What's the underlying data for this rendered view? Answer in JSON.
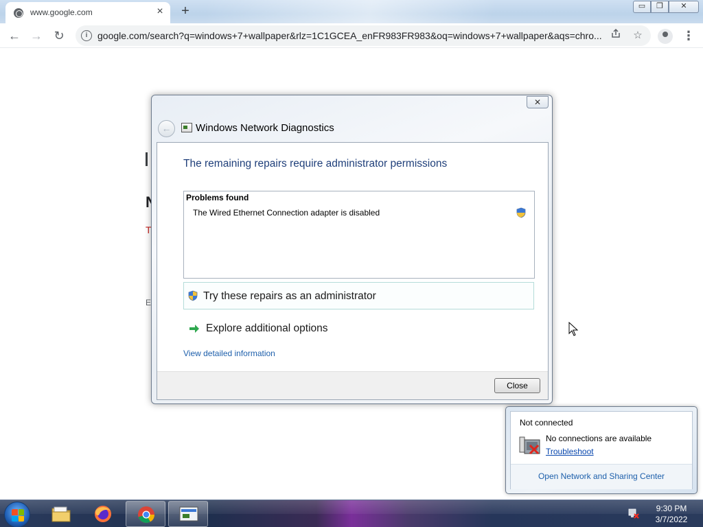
{
  "browser": {
    "tab_title": "www.google.com",
    "tab_close": "×",
    "new_tab": "+",
    "url": "google.com/search?q=windows+7+wallpaper&rlz=1C1GCEA_enFR983FR983&oq=windows+7+wallpaper&aqs=chro...",
    "window_controls": {
      "minimize": "▭",
      "maximize": "❐",
      "close": "✕"
    },
    "nav": {
      "back": "←",
      "forward": "→",
      "reload": "↻"
    },
    "menu": "⋮",
    "info_glyph": "i"
  },
  "page_fragments": {
    "frag1": "N",
    "frag2": "T",
    "frag3": "E"
  },
  "dialog": {
    "title": "Windows Network Diagnostics",
    "close_glyph": "✕",
    "heading": "The remaining repairs require administrator permissions",
    "problems_header": "Problems found",
    "problem_item": "The Wired Ethernet Connection adapter is disabled",
    "try_repairs": "Try these repairs as an administrator",
    "explore": "Explore additional options",
    "view_details": "View detailed information",
    "close_button": "Close"
  },
  "popup": {
    "status": "Not connected",
    "message": "No connections are available",
    "troubleshoot": "Troubleshoot",
    "open_center": "Open Network and Sharing Center"
  },
  "taskbar": {
    "time": "9:30 PM",
    "date": "3/7/2022",
    "apps": [
      "file-explorer",
      "firefox",
      "chrome",
      "network-diagnostics"
    ]
  },
  "colors": {
    "heading": "#1f3f7a",
    "link": "#1d5fab",
    "taskbar": "#2a3b5c"
  }
}
